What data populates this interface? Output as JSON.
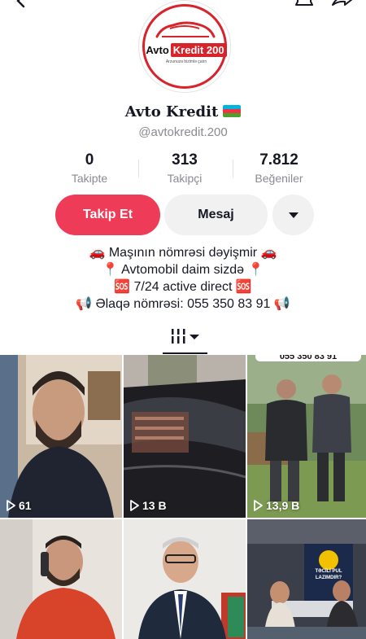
{
  "profile": {
    "display_name": "Avto Kredit",
    "username": "@avtokredit.200",
    "logo": {
      "word1": "Avto",
      "word2": "Kredit 200",
      "tagline": "Arzunuza bizimlə çatın"
    }
  },
  "stats": [
    {
      "value": "0",
      "label": "Takipte"
    },
    {
      "value": "313",
      "label": "Takipçi"
    },
    {
      "value": "7.812",
      "label": "Beğeniler"
    }
  ],
  "actions": {
    "follow_label": "Takip Et",
    "message_label": "Mesaj"
  },
  "bio": [
    "🚗 Maşının nömrəsi dəyişmir 🚗",
    "📍 Avtomobil daim sizdə 📍",
    "🆘 7/24 active direct 🆘",
    "📢 Əlaqə nömrəsi: 055 350 83 91 📢"
  ],
  "videos": [
    {
      "views": "61"
    },
    {
      "views": "13 B"
    },
    {
      "views": "13,9 B"
    },
    {
      "views": ""
    },
    {
      "views": ""
    },
    {
      "views": ""
    }
  ],
  "video3_overlay": "055 350 83 91",
  "video6_overlay": "TƏCİLİ PUL LAZIMDIR?",
  "colors": {
    "accent": "#ee3b57",
    "brand_red": "#d8232a",
    "muted": "#8a8b91"
  },
  "icons": [
    "back-icon",
    "bell-icon",
    "share-icon",
    "grid-tab-icon",
    "caret-down-icon",
    "play-icon"
  ]
}
